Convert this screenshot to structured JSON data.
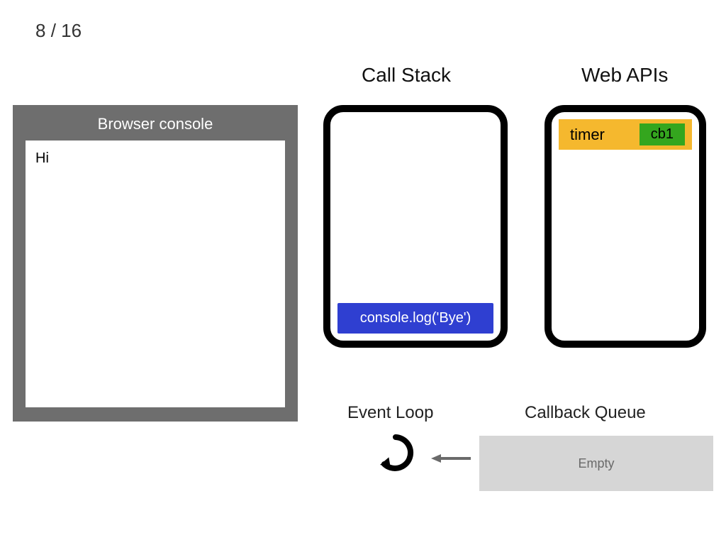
{
  "slide": {
    "current": 8,
    "total": 16,
    "separator": " / "
  },
  "console": {
    "title": "Browser console",
    "lines": [
      "Hi"
    ]
  },
  "headings": {
    "call_stack": "Call Stack",
    "web_apis": "Web APIs",
    "event_loop": "Event Loop",
    "callback_queue": "Callback Queue"
  },
  "call_stack": {
    "frames": [
      "console.log('Bye')"
    ]
  },
  "web_apis": {
    "items": [
      {
        "label": "timer",
        "callback": "cb1"
      }
    ]
  },
  "callback_queue": {
    "empty_label": "Empty",
    "items": []
  },
  "colors": {
    "console_frame": "#6e6e6e",
    "stack_frame_bg": "#2f3fd1",
    "timer_bg": "#f5b82e",
    "callback_bg": "#34a61e",
    "queue_bg": "#d6d6d6",
    "arrow": "#6a6a6a"
  }
}
